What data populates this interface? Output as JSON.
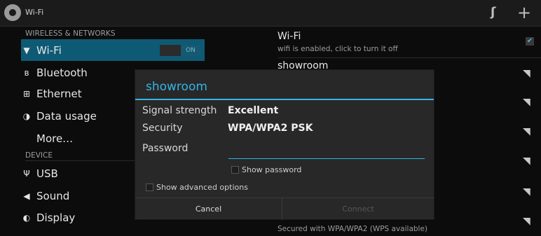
{
  "actionbar": {
    "title": "Wi-Fi",
    "icons": [
      "settings-gear-icon",
      "wps-icon",
      "add-icon"
    ]
  },
  "sidebar": {
    "section_wireless": "WIRELESS & NETWORKS",
    "section_device": "DEVICE",
    "items": [
      {
        "label": "Wi-Fi",
        "icon": "wifi-icon",
        "selected": true,
        "toggle": "ON"
      },
      {
        "label": "Bluetooth",
        "icon": "bluetooth-icon"
      },
      {
        "label": "Ethernet",
        "icon": "ethernet-icon"
      },
      {
        "label": "Data usage",
        "icon": "data-usage-icon"
      },
      {
        "label": "More…"
      },
      {
        "label": "USB",
        "icon": "usb-icon"
      },
      {
        "label": "Sound",
        "icon": "sound-icon"
      },
      {
        "label": "Display",
        "icon": "display-icon"
      }
    ]
  },
  "wifi_panel": {
    "title": "Wi-Fi",
    "subtitle": "wifi is enabled, click to turn it off",
    "networks": [
      {
        "name": "showroom"
      },
      {
        "name": "",
        "security": "Secured with WPA/WPA2 (WPS available)"
      }
    ]
  },
  "dialog": {
    "title": "showroom",
    "signal_label": "Signal strength",
    "signal_value": "Excellent",
    "security_label": "Security",
    "security_value": "WPA/WPA2 PSK",
    "password_label": "Password",
    "password_value": "",
    "show_password": "Show password",
    "show_advanced": "Show advanced options",
    "cancel": "Cancel",
    "connect": "Connect"
  },
  "colors": {
    "accent": "#33b5e5",
    "selected_bg": "#0e5a74",
    "dialog_bg": "#282828",
    "background": "#0c0c0c"
  }
}
